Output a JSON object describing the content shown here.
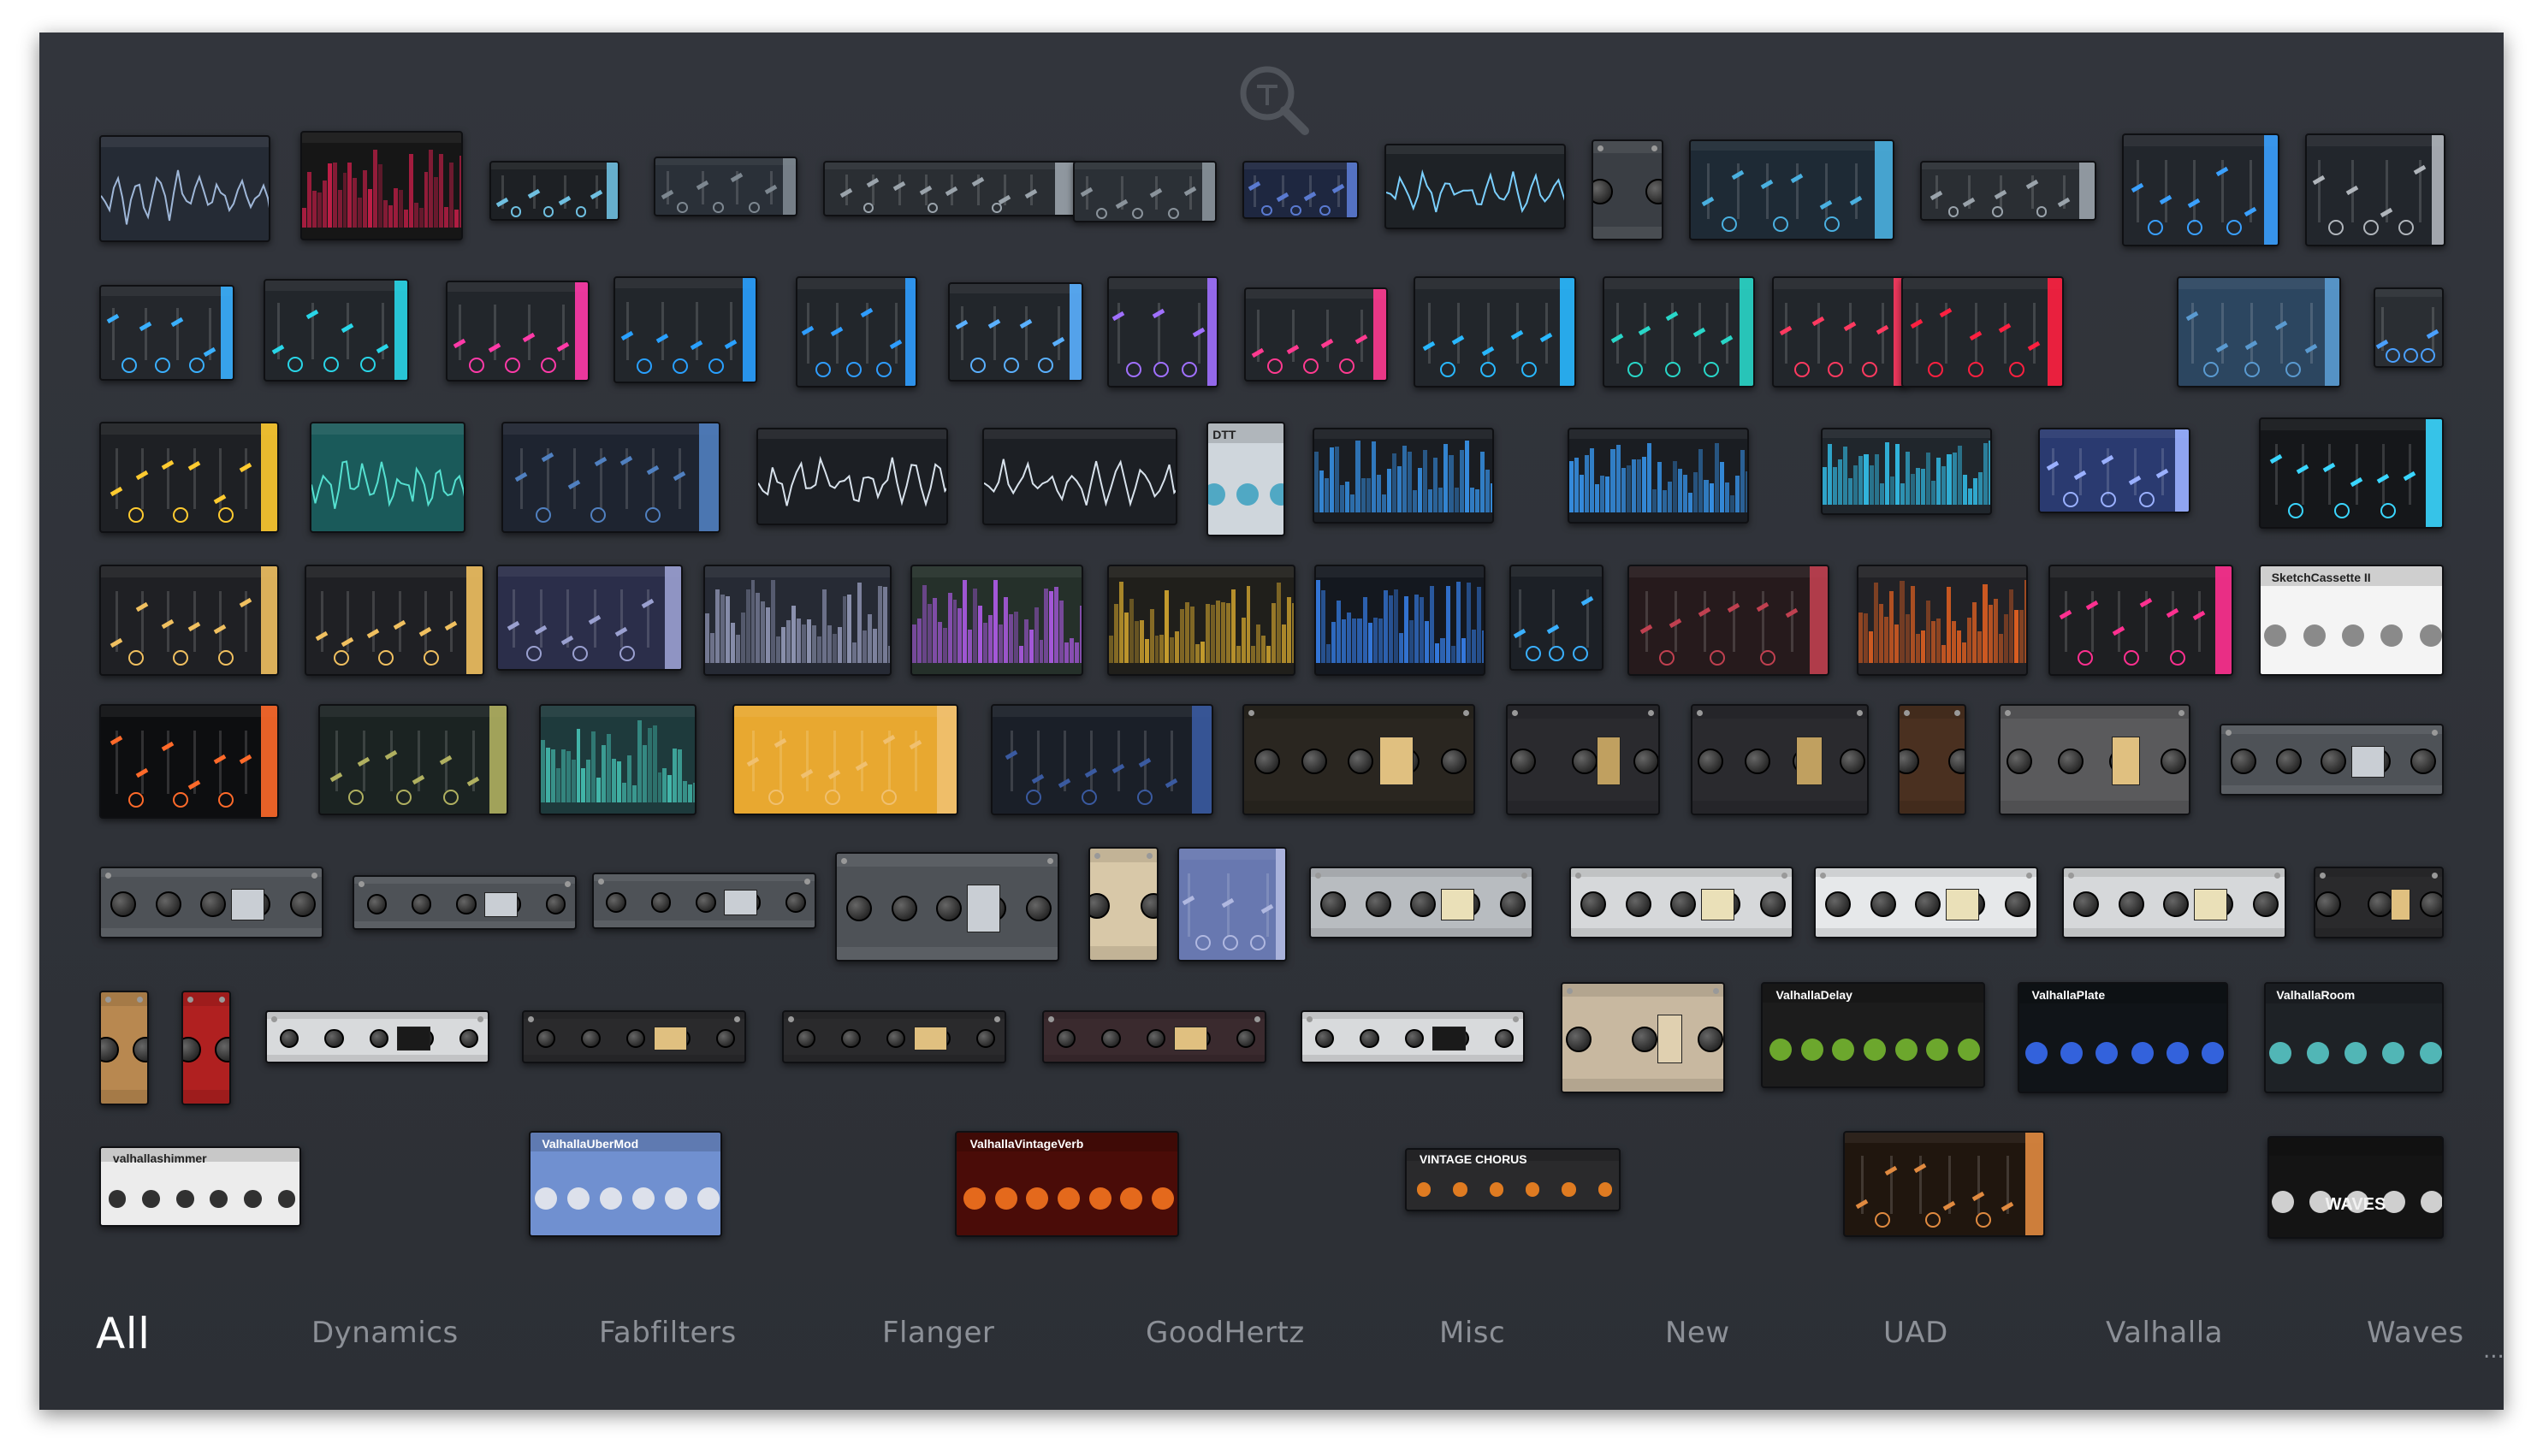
{
  "category_tabs": [
    {
      "label": "All",
      "active": true
    },
    {
      "label": "Dynamics",
      "active": false
    },
    {
      "label": "Fabfilters",
      "active": false
    },
    {
      "label": "Flanger",
      "active": false
    },
    {
      "label": "GoodHertz",
      "active": false
    },
    {
      "label": "Misc",
      "active": false
    },
    {
      "label": "New",
      "active": false
    },
    {
      "label": "UAD",
      "active": false
    },
    {
      "label": "Valhalla",
      "active": false
    },
    {
      "label": "Waves",
      "active": false
    }
  ],
  "overflow_indicator": "...",
  "search_icon": "search-icon",
  "plugin_labels": {
    "valhalla_shimmer": "valhallashimmer",
    "valhalla_ubermod": "ValhallaUberMod",
    "valhalla_vintageverb": "ValhallaVintageVerb",
    "vintage_chorus": "VINTAGE CHORUS",
    "valhalla_delay": "ValhallaDelay",
    "valhalla_plate": "ValhallaPlate",
    "valhalla_room": "ValhallaRoom",
    "sketch_cassette": "SketchCassette II",
    "waves": "WAVES",
    "dtt": "DTT"
  },
  "colors": {
    "window_bg": "#2f3238",
    "tab_active": "#ffffff",
    "tab_inactive": "#8c9097"
  }
}
